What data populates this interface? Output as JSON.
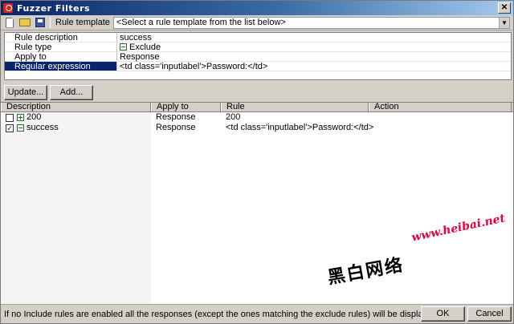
{
  "window": {
    "title": "Fuzzer Filters"
  },
  "toolbar": {
    "label": "Rule template",
    "combo_value": "<Select a rule template from the list below>"
  },
  "properties": [
    {
      "key": "Rule description",
      "value": "success"
    },
    {
      "key": "Rule type",
      "value": "Exclude",
      "icon": "minus-icon"
    },
    {
      "key": "Apply to",
      "value": "Response"
    },
    {
      "key": "Regular expression",
      "value": "<td class='inputlabel'>Password:</td>",
      "selected": true
    }
  ],
  "buttons": {
    "update": "Update...",
    "add": "Add...",
    "ok": "OK",
    "cancel": "Cancel"
  },
  "list": {
    "columns": [
      "Description",
      "Apply to",
      "Rule",
      "Action"
    ],
    "rows": [
      {
        "checked": false,
        "type": "include",
        "description": "200",
        "apply_to": "Response",
        "rule": "200",
        "action": ""
      },
      {
        "checked": true,
        "type": "exclude",
        "description": "success",
        "apply_to": "Response",
        "rule": "<td class='inputlabel'>Password:</td>",
        "action": ""
      }
    ]
  },
  "status": {
    "text": "If no Include rules are enabled all the responses (except the ones matching the exclude rules) will be displayed."
  },
  "watermark": {
    "url": "www.heibai.net",
    "cn": "黑白网络"
  },
  "colors": {
    "titlebar": "#0a246a",
    "selection": "#0a246a",
    "watermark_red": "#e8003a"
  }
}
